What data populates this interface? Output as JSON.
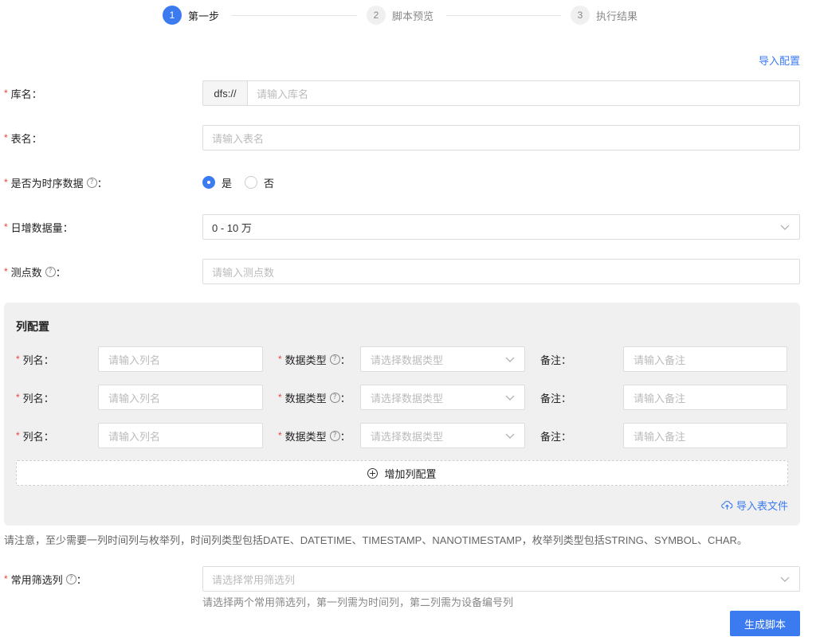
{
  "steps": [
    {
      "num": "1",
      "label": "第一步"
    },
    {
      "num": "2",
      "label": "脚本预览"
    },
    {
      "num": "3",
      "label": "执行结果"
    }
  ],
  "import_config": "导入配置",
  "form": {
    "db_name": {
      "label": "库名",
      "prefix": "dfs://",
      "placeholder": "请输入库名"
    },
    "table_name": {
      "label": "表名",
      "placeholder": "请输入表名"
    },
    "is_timeseries": {
      "label": "是否为时序数据",
      "options": [
        "是",
        "否"
      ],
      "selected": "是"
    },
    "daily_volume": {
      "label": "日增数据量",
      "value": "0 - 10 万"
    },
    "points": {
      "label": "测点数",
      "placeholder": "请输入测点数"
    }
  },
  "column_config": {
    "title": "列配置",
    "rows": [
      {
        "name_label": "列名",
        "name_placeholder": "请输入列名",
        "type_label": "数据类型",
        "type_placeholder": "请选择数据类型",
        "remark_label": "备注",
        "remark_placeholder": "请输入备注"
      },
      {
        "name_label": "列名",
        "name_placeholder": "请输入列名",
        "type_label": "数据类型",
        "type_placeholder": "请选择数据类型",
        "remark_label": "备注",
        "remark_placeholder": "请输入备注"
      },
      {
        "name_label": "列名",
        "name_placeholder": "请输入列名",
        "type_label": "数据类型",
        "type_placeholder": "请选择数据类型",
        "remark_label": "备注",
        "remark_placeholder": "请输入备注"
      }
    ],
    "add_label": "增加列配置",
    "import_file": "导入表文件"
  },
  "notice": "请注意，至少需要一列时间列与枚举列，时间列类型包括DATE、DATETIME、TIMESTAMP、NANOTIMESTAMP，枚举列类型包括STRING、SYMBOL、CHAR。",
  "filter": {
    "label": "常用筛选列",
    "placeholder": "请选择常用筛选列",
    "hint": "请选择两个常用筛选列，第一列需为时间列，第二列需为设备编号列"
  },
  "generate_button": "生成脚本",
  "colors": {
    "accent": "#3c7af0",
    "required": "#e8453c"
  }
}
